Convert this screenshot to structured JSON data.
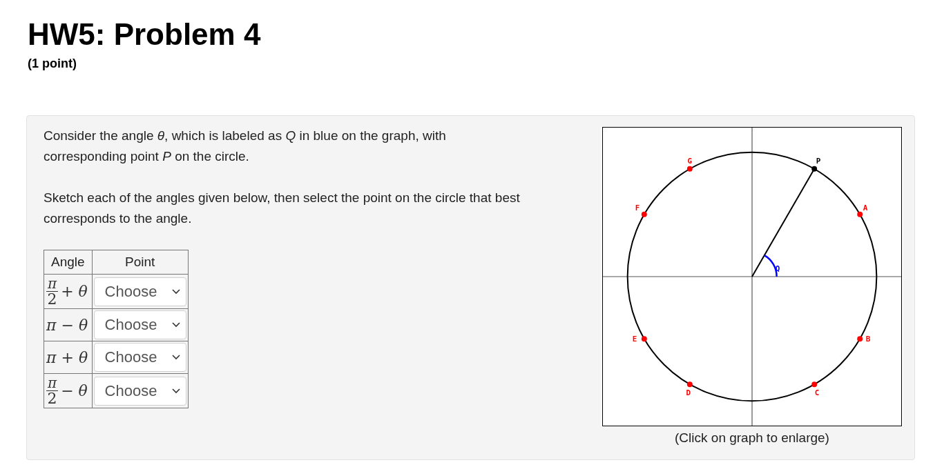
{
  "title": "HW5: Problem 4",
  "points_value": "(1 point)",
  "problem": {
    "paragraphs": [
      "Consider the angle *θ*, which is labeled as *Q* in blue on the graph, with corresponding point *P* on the circle.",
      "Sketch each of the angles given below, then select the point on the circle that best corresponds to the angle."
    ],
    "table": {
      "columns": [
        "Angle",
        "Point"
      ],
      "rows": [
        {
          "angle": {
            "kind": "fraction",
            "numerator": "π",
            "denominator": "2",
            "rest": "+ θ"
          },
          "choice": "Choose"
        },
        {
          "angle": {
            "kind": "plain",
            "text": "π − θ"
          },
          "choice": "Choose"
        },
        {
          "angle": {
            "kind": "plain",
            "text": "π + θ"
          },
          "choice": "Choose"
        },
        {
          "angle": {
            "kind": "fraction",
            "numerator": "π",
            "denominator": "2",
            "rest": "− θ"
          },
          "choice": "Choose"
        }
      ]
    },
    "graph": {
      "angle_label": "Q",
      "terminal_point": {
        "label": "P"
      },
      "points": [
        {
          "label": "A"
        },
        {
          "label": "B"
        },
        {
          "label": "C"
        },
        {
          "label": "D"
        },
        {
          "label": "E"
        },
        {
          "label": "F"
        },
        {
          "label": "G"
        }
      ],
      "caption": "(Click on graph to enlarge)"
    }
  }
}
